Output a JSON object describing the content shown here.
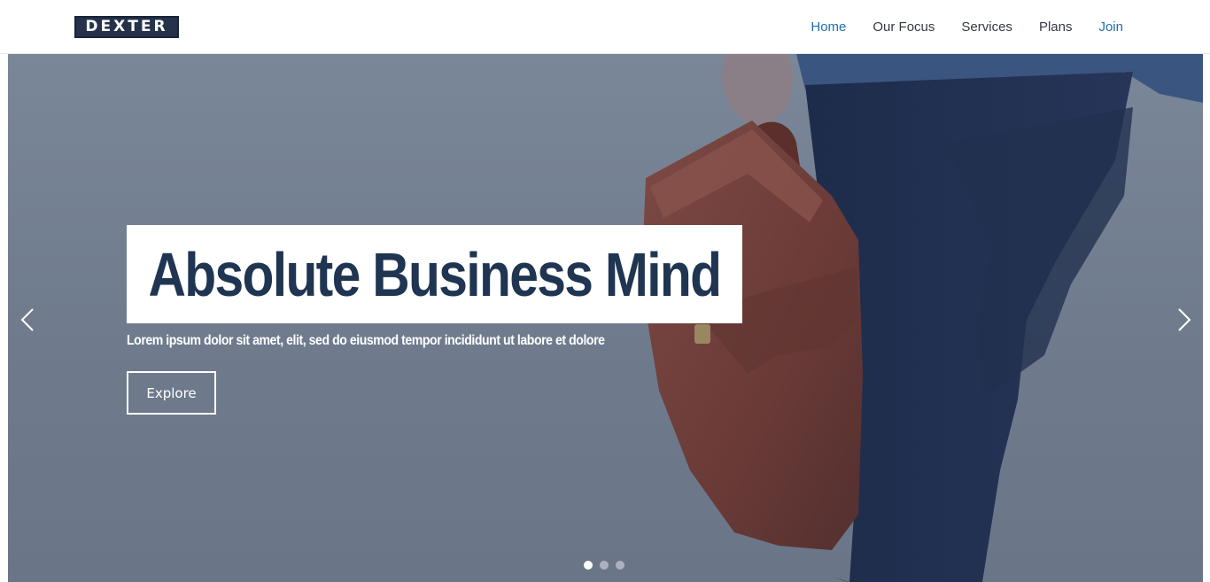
{
  "brand": {
    "logo_text": "DEXTER"
  },
  "nav": {
    "items": [
      {
        "label": "Home"
      },
      {
        "label": "Our Focus"
      },
      {
        "label": "Services"
      },
      {
        "label": "Plans"
      },
      {
        "label": "Join"
      }
    ],
    "active_item": "Home"
  },
  "hero": {
    "headline": "Absolute Business Mind",
    "subline": "Lorem ipsum dolor sit amet, elit, sed do eiusmod tempor incididunt ut labore et dolore",
    "cta_label": "Explore",
    "slide_count": 3,
    "active_slide": 1
  },
  "colors": {
    "accent": "#1d6fae",
    "headline": "#1f3551",
    "overlay": "#6f7b8d",
    "logo_bg": "#25324a"
  },
  "icons": {
    "prev": "chevron-left-icon",
    "next": "chevron-right-icon"
  }
}
